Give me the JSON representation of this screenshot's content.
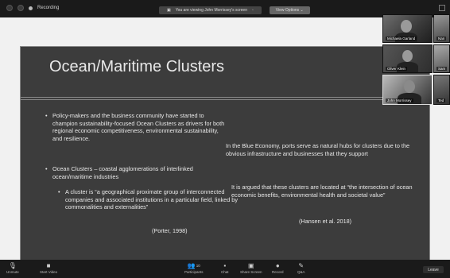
{
  "topbar": {
    "recording_label": "Recording",
    "share_notice": "You are viewing John Morrissey's screen",
    "view_options": "View Options"
  },
  "slide": {
    "title": "Ocean/Maritime Clusters",
    "bullets": [
      "Policy-makers and the business community have started to champion sustainability-focused Ocean Clusters as drivers for both regional economic competitiveness, environmental sustainability, and resilience.",
      "Ocean Clusters – coastal agglomerations of interlinked ocean/maritime industries"
    ],
    "sub_bullet": "A cluster is “a geographical proximate group of interconnected companies and associated institutions in a particular field, linked by commonalities and externalities”",
    "citation1": "(Porter, 1998)",
    "para1": "In the Blue Economy, ports serve as natural hubs for clusters due to the obvious infrastructure and businesses that they support",
    "para2": "It is argued that these clusters are located at “the intersection of ocean economic benefits, environmental health and societal value”",
    "citation2": "(Hansen et al. 2018)"
  },
  "participants": [
    {
      "name": "Michaela Garland"
    },
    {
      "name": "Nan"
    },
    {
      "name": "Oliver Klein"
    },
    {
      "name": "Sam"
    },
    {
      "name": "John Morrissey"
    },
    {
      "name": "Ted"
    }
  ],
  "toolbar": {
    "unmute": "Unmute",
    "start_video": "Start Video",
    "participants": "Participants",
    "participants_count": "10",
    "chat": "Chat",
    "share_screen": "Share Screen",
    "record": "Record",
    "qa": "Q&A",
    "leave": "Leave"
  }
}
